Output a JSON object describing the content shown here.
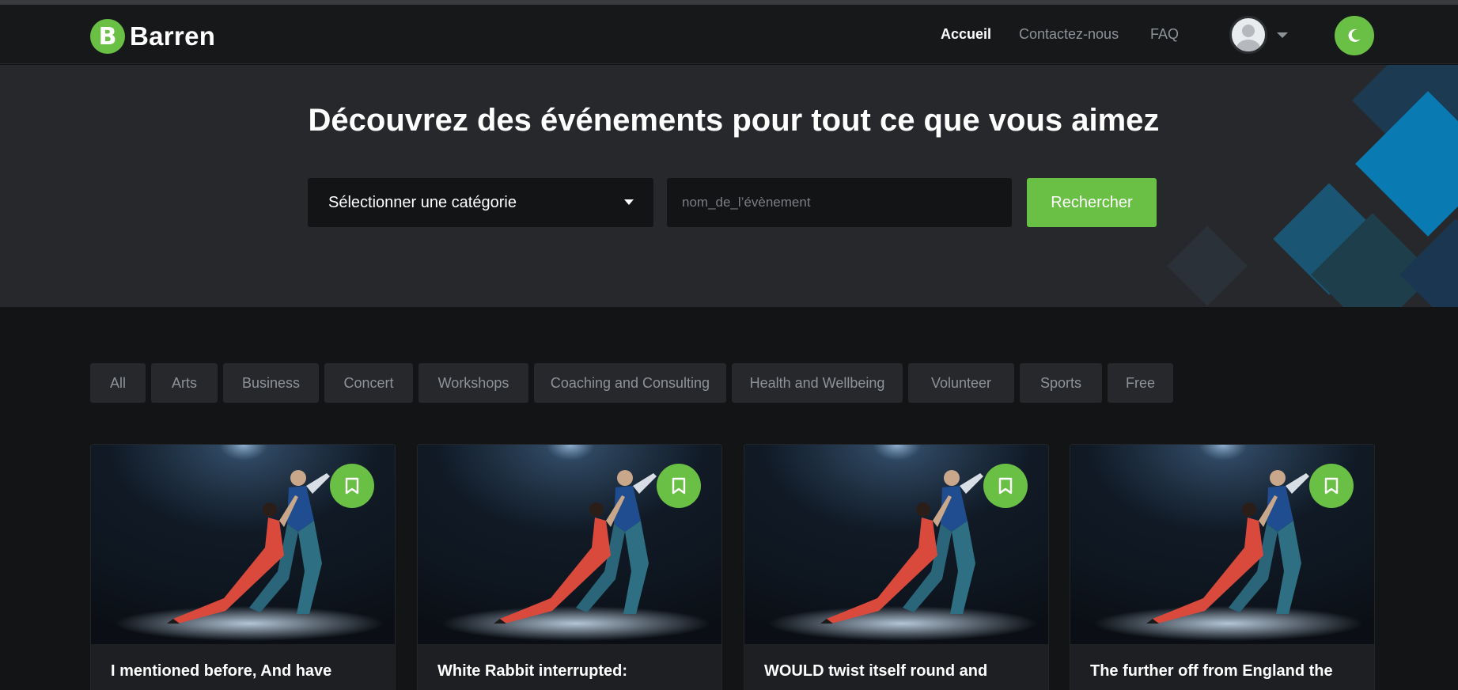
{
  "brand": {
    "initial": "B",
    "name": "Barren"
  },
  "nav": {
    "home": "Accueil",
    "contact": "Contactez-nous",
    "faq": "FAQ"
  },
  "hero": {
    "title": "Découvrez des événements pour tout ce que vous aimez",
    "category_select": "Sélectionner une catégorie",
    "search_placeholder": "nom_de_l’évènement",
    "search_button": "Rechercher"
  },
  "filters": [
    "All",
    "Arts",
    "Business",
    "Concert",
    "Workshops",
    "Coaching and Consulting",
    "Health and Wellbeing",
    "Volunteer",
    "Sports",
    "Free"
  ],
  "events": [
    {
      "title": "I mentioned before, And have grown"
    },
    {
      "title": "White Rabbit interrupted:"
    },
    {
      "title": "WOULD twist itself round and swam"
    },
    {
      "title": "The further off from England the"
    }
  ],
  "colors": {
    "accent": "#6ac045",
    "background": "#131416",
    "hero": "#26282c",
    "chip": "#26282c"
  },
  "icons": {
    "theme": "moon-icon",
    "bookmark": "bookmark-icon",
    "avatar": "user-avatar-icon",
    "dropdown": "caret-down-icon"
  }
}
